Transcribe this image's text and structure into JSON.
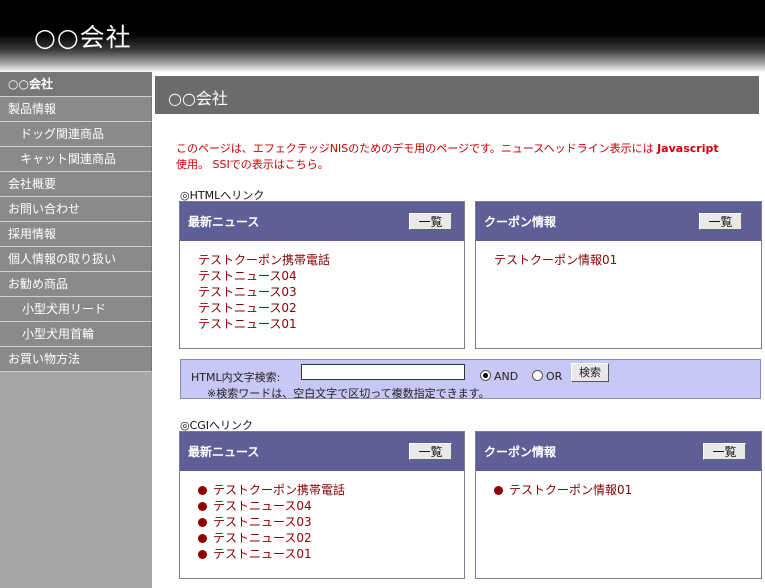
{
  "header": {
    "logo": "○○会社"
  },
  "sidebar": {
    "items": [
      {
        "label": "○○会社",
        "kind": "top"
      },
      {
        "label": "製品情報",
        "kind": "main"
      },
      {
        "label": "ドッグ関連商品",
        "kind": "sub"
      },
      {
        "label": "キャット関連商品",
        "kind": "sub"
      },
      {
        "label": "会社概要",
        "kind": "main"
      },
      {
        "label": "お問い合わせ",
        "kind": "main"
      },
      {
        "label": "採用情報",
        "kind": "main"
      },
      {
        "label": "個人情報の取り扱い",
        "kind": "main"
      },
      {
        "label": "お勧め商品",
        "kind": "main"
      },
      {
        "label": "小型犬用リード",
        "kind": "sub2"
      },
      {
        "label": "小型犬用首輪",
        "kind": "sub2"
      },
      {
        "label": "お買い物方法",
        "kind": "main"
      }
    ]
  },
  "main": {
    "title": "○○会社",
    "notice_line1": "このページは、エフェクテッジNISのためのデモ用のページです。ニュースヘッドライン表示には",
    "notice_js": "Javascript",
    "notice_line2": "使用。 SSIでの表示はこちら。",
    "html_section": "◎HTMLへリンク",
    "cgi_section": "◎CGIへリンク",
    "list_button": "一覧",
    "news_header": "最新ニュース",
    "coupon_header": "クーポン情報",
    "html_news": [
      "テストクーポン携帯電話",
      "テストニュース04",
      "テストニュース03",
      "テストニュース02",
      "テストニュース01"
    ],
    "html_coupons": [
      "テストクーポン情報01"
    ],
    "cgi_news": [
      "テストクーポン携帯電話",
      "テストニュース04",
      "テストニュース03",
      "テストニュース02",
      "テストニュース01"
    ],
    "cgi_coupons": [
      "テストクーポン情報01"
    ],
    "search": {
      "label": "HTML内文字検索:",
      "value": "",
      "and_label": "AND",
      "or_label": "OR",
      "selected": "AND",
      "button": "検索",
      "note": "※検索ワードは、空白文字で区切って複数指定できます。"
    }
  }
}
